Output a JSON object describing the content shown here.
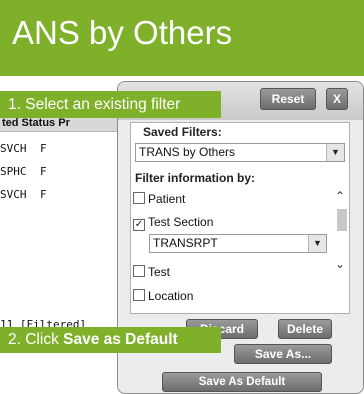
{
  "header": {
    "title": "ANS by Others"
  },
  "table": {
    "column_header": "ted Status Pr",
    "rows": [
      {
        "col1": "SVCH",
        "col2": "F"
      },
      {
        "col1": "SPHC",
        "col2": "F"
      },
      {
        "col1": "SVCH",
        "col2": "F"
      }
    ],
    "footer_count": "11 [Filtered]"
  },
  "panel": {
    "reset_label": "Reset",
    "close_label": "X",
    "saved_filters_label": "Saved Filters:",
    "saved_filter_value": "TRANS by Others",
    "filter_info_label": "Filter information by:",
    "options": [
      {
        "label": "Patient",
        "checked": false
      },
      {
        "label": "Test Section",
        "checked": true
      },
      {
        "label": "Test",
        "checked": false
      },
      {
        "label": "Location",
        "checked": false
      }
    ],
    "test_section_value": "TRANSRPT",
    "discard_label": "Discard",
    "delete_label": "Delete",
    "save_as_label": "Save As...",
    "save_default_label": "Save As Default"
  },
  "callouts": {
    "step1": "1. Select an existing filter",
    "step2_prefix": "2. Click ",
    "step2_bold": "Save as Default"
  },
  "colors": {
    "accent": "#7fb02a",
    "button": "#7a7a7a"
  },
  "icons": {
    "dropdown": "chevron-down-icon",
    "scroll_up": "chevron-up-icon",
    "scroll_down": "chevron-down-icon",
    "checkbox": "checkmark-icon"
  }
}
